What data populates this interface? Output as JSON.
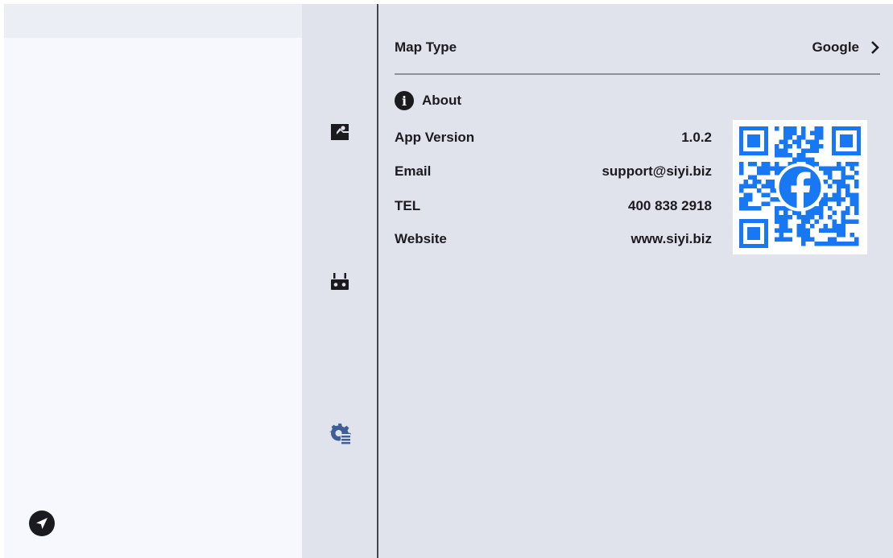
{
  "nav": {
    "items": [
      {
        "name": "map",
        "icon": "map-icon"
      },
      {
        "name": "remote",
        "icon": "remote-controller-icon"
      },
      {
        "name": "settings",
        "icon": "settings-icon"
      }
    ]
  },
  "settings": {
    "map_type": {
      "label": "Map Type",
      "value": "Google"
    },
    "about": {
      "title": "About",
      "rows": [
        {
          "label": "App Version",
          "value": "1.0.2"
        },
        {
          "label": "Email",
          "value": "support@siyi.biz"
        },
        {
          "label": "TEL",
          "value": "400 838 2918"
        },
        {
          "label": "Website",
          "value": "www.siyi.biz"
        }
      ]
    },
    "qr": {
      "icon": "facebook-icon"
    }
  },
  "colors": {
    "accent": "#3e5f95",
    "qr_blue": "#1877f2",
    "panel": "#e0e2ec",
    "left_panel": "#f6f8fd",
    "text": "#1b1b1f"
  }
}
